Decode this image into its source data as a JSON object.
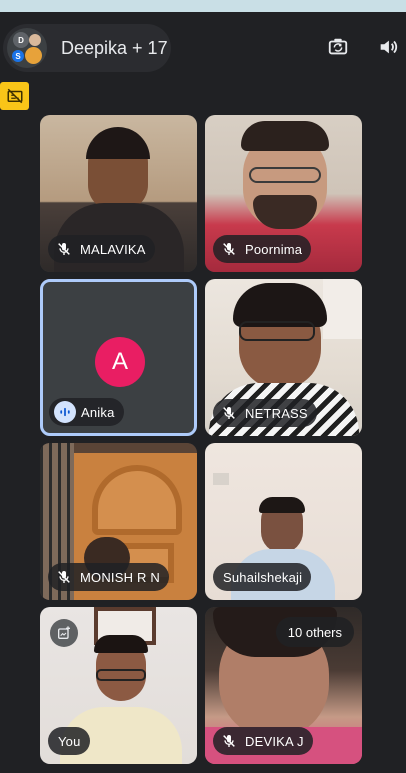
{
  "header": {
    "call_title": "Deepika + 17",
    "avatar_initials": [
      "D",
      "S"
    ]
  },
  "tiles": [
    {
      "name": "MALAVIKA",
      "muted": true
    },
    {
      "name": "Poornima",
      "muted": true
    },
    {
      "name": "Anika",
      "speaking": true,
      "avatar_letter": "A",
      "avatar_color": "#e91e63"
    },
    {
      "name": "NETRASS",
      "muted": true
    },
    {
      "name": "MONISH R N",
      "muted": true
    },
    {
      "name": "Suhailshekaji",
      "muted": false
    },
    {
      "name": "You",
      "muted": false
    },
    {
      "name": "DEVIKA J",
      "muted": true,
      "overflow_label": "10 others"
    }
  ],
  "icons": {
    "topbar": [
      "camera-flip-icon",
      "speaker-icon"
    ],
    "captions": "captions-off-icon"
  },
  "colors": {
    "background": "#202124",
    "speaking_border": "#aecbfa",
    "caption_toggle": "#f9c518"
  }
}
